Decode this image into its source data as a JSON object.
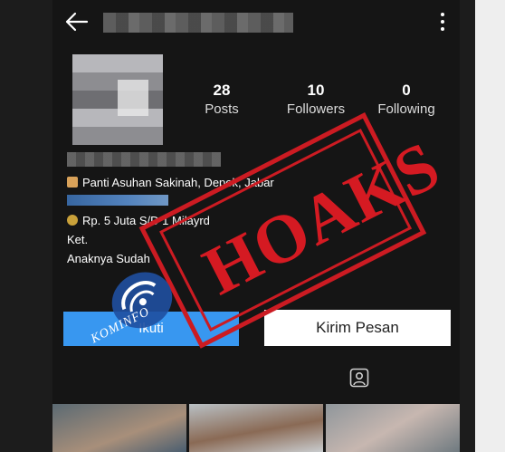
{
  "profile": {
    "posts_count": "28",
    "posts_label": "Posts",
    "followers_count": "10",
    "followers_label": "Followers",
    "following_count": "0",
    "following_label": "Following"
  },
  "bio": {
    "location": "Panti Asuhan Sakinah, Depok, Jabar",
    "price": "Rp. 5 Juta S/D 1 Milayrd",
    "note_label": "Ket.",
    "note_text": "Anaknya Sudah"
  },
  "buttons": {
    "follow_label": "Ikuti",
    "message_label": "Kirim Pesan"
  },
  "overlay": {
    "stamp_text": "HOAKS",
    "logo_text": "KOMINFO"
  },
  "colors": {
    "accent": "#3897f0",
    "stamp": "#cc1b22",
    "background": "#151515"
  },
  "icons": {
    "back": "back-arrow-icon",
    "more": "more-vertical-icon",
    "tagged": "tagged-person-icon",
    "location": "house-icon",
    "money": "money-bag-icon"
  }
}
